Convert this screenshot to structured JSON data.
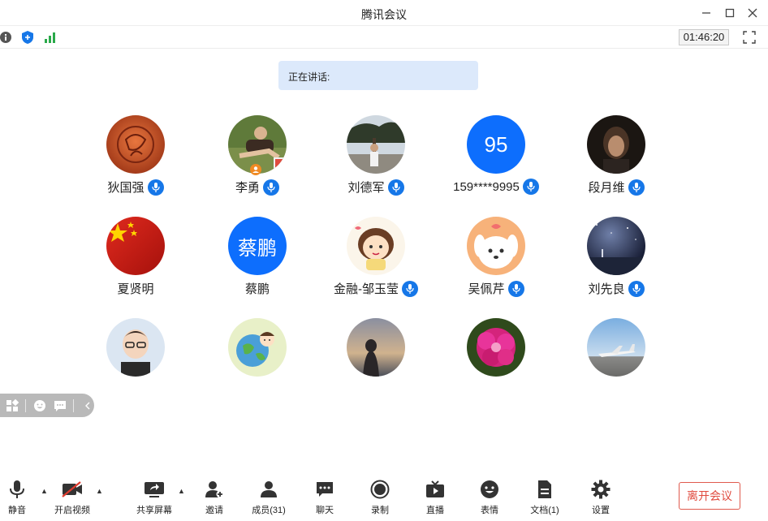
{
  "window": {
    "title": "腾讯会议"
  },
  "infobar": {
    "timer": "01:46:20"
  },
  "speaking": {
    "label": "正在讲话:"
  },
  "participants": [
    {
      "name": "狄国强",
      "mic": true,
      "avatar": "seal-photo"
    },
    {
      "name": "李勇",
      "mic": true,
      "avatar": "outdoor-photo"
    },
    {
      "name": "刘德军",
      "mic": true,
      "avatar": "tree-photo"
    },
    {
      "name": "159****9995",
      "mic": true,
      "avatar_text": "95"
    },
    {
      "name": "段月维",
      "mic": true,
      "avatar": "dark-portrait-photo"
    },
    {
      "name": "夏贤明",
      "mic": false,
      "avatar": "flag-photo"
    },
    {
      "name": "蔡鹏",
      "mic": false,
      "avatar_text": "蔡鹏"
    },
    {
      "name": "金融-邹玉莹",
      "mic": true,
      "avatar": "cartoon-girl"
    },
    {
      "name": "吴佩芹",
      "mic": true,
      "avatar": "cartoon-dog"
    },
    {
      "name": "刘先良",
      "mic": true,
      "avatar": "night-sky-photo"
    },
    {
      "name": "",
      "mic": false,
      "avatar": "cartoon-man"
    },
    {
      "name": "",
      "mic": false,
      "avatar": "cartoon-globe"
    },
    {
      "name": "",
      "mic": false,
      "avatar": "sunset-silhouette"
    },
    {
      "name": "",
      "mic": false,
      "avatar": "pink-flower"
    },
    {
      "name": "",
      "mic": false,
      "avatar": "airplane-photo"
    }
  ],
  "toolbar": {
    "mute": "静音",
    "video": "开启视频",
    "share": "共享屏幕",
    "invite": "邀请",
    "members": "成员(31)",
    "chat": "聊天",
    "record": "录制",
    "live": "直播",
    "emoji": "表情",
    "docs": "文档(1)",
    "settings": "设置",
    "leave": "离开会议"
  },
  "colors": {
    "accent": "#1677e8",
    "avatar_blue": "#0d6efd",
    "leave_red": "#e04b3f",
    "speaking_bg": "#dce9fb"
  }
}
